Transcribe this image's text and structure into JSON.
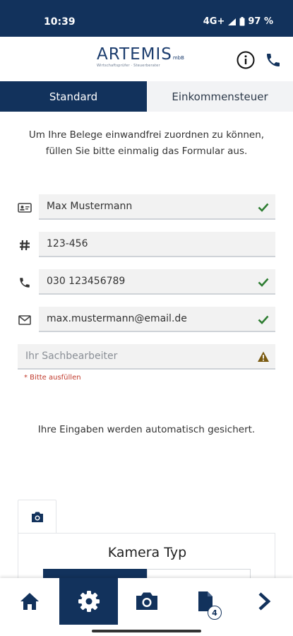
{
  "status_bar": {
    "time": "10:39",
    "network": "4G+",
    "battery": "97 %"
  },
  "header": {
    "logo_word": "ARTEMIS",
    "logo_suffix": "mbB",
    "logo_sub": "Wirtschaftsprüfer · Steuerberater",
    "info_icon": "info-icon",
    "phone_icon": "phone-icon"
  },
  "tabs": [
    {
      "label": "Standard",
      "active": true
    },
    {
      "label": "Einkommensteuer",
      "active": false
    }
  ],
  "intro_text": "Um Ihre Belege einwandfrei zuordnen zu können, füllen Sie bitte einmalig das Formular aus.",
  "form": {
    "name": {
      "value": "Max Mustermann",
      "status": "valid"
    },
    "number": {
      "value": "123-456"
    },
    "phone": {
      "value": "030 123456789",
      "status": "valid"
    },
    "email": {
      "value": "max.mustermann@email.de",
      "status": "valid"
    },
    "sachbearbeiter": {
      "placeholder": "Ihr Sachbearbeiter",
      "status": "warning",
      "error": "* Bitte ausfüllen"
    }
  },
  "autosave_text": "Ihre Eingaben werden automatisch gesichert.",
  "camera": {
    "tab_icon": "camera-icon",
    "title": "Kamera Typ"
  },
  "bottom_nav": {
    "items": [
      "home-icon",
      "settings-icon",
      "camera-icon",
      "document-icon",
      "next-icon"
    ],
    "active": "settings-icon",
    "document_badge": "4"
  },
  "colors": {
    "primary": "#12325c",
    "valid": "#2e7d32",
    "warning": "#7a5a10",
    "error": "#c0392b"
  }
}
